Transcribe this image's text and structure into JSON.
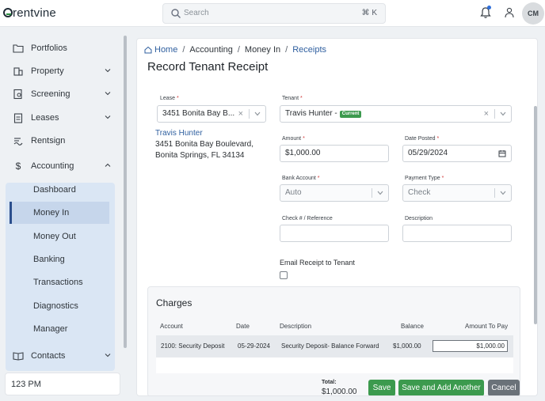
{
  "app": {
    "logo_text": "rentvine"
  },
  "search": {
    "placeholder": "Search",
    "shortcut": "⌘ K"
  },
  "header": {
    "avatar_initials": "CM",
    "notification_color": "#2f6fda"
  },
  "sidebar": {
    "items": [
      {
        "label": "Portfolios",
        "icon": "folder-icon"
      },
      {
        "label": "Property",
        "icon": "building-icon"
      },
      {
        "label": "Screening",
        "icon": "screening-icon"
      },
      {
        "label": "Leases",
        "icon": "clipboard-icon"
      },
      {
        "label": "Rentsign",
        "icon": "sign-icon"
      },
      {
        "label": "Accounting",
        "icon": "dollar-icon"
      },
      {
        "label": "Contacts",
        "icon": "book-icon"
      }
    ],
    "accounting_sub": [
      "Dashboard",
      "Money In",
      "Money Out",
      "Banking",
      "Transactions",
      "Diagnostics",
      "Manager"
    ],
    "active_sub": "Money In",
    "time_text": "123 PM"
  },
  "breadcrumb": {
    "home": "Home",
    "accounting": "Accounting",
    "money_in": "Money In",
    "current": "Receipts"
  },
  "page_title": "Record Tenant Receipt",
  "form": {
    "lease_label": "Lease",
    "lease_value": "3451 Bonita Bay B...",
    "tenant_label": "Tenant",
    "tenant_value": "Travis Hunter -",
    "tenant_badge": "Current",
    "tenant_link": "Travis Hunter",
    "address_line1": "3451 Bonita Bay Boulevard,",
    "address_line2": "Bonita Springs, FL 34134",
    "amount_label": "Amount",
    "amount_value": "$1,000.00",
    "date_label": "Date Posted",
    "date_value": "05/29/2024",
    "bank_label": "Bank Account",
    "bank_value": "Auto",
    "payment_label": "Payment Type",
    "payment_value": "Check",
    "check_label": "Check # / Reference",
    "check_value": "",
    "desc_label": "Description",
    "desc_value": "",
    "email_label": "Email Receipt to Tenant",
    "required_mark": "*"
  },
  "charges": {
    "title": "Charges",
    "columns": [
      "Account",
      "Date",
      "Description",
      "Balance",
      "Amount To Pay"
    ],
    "rows": [
      {
        "account": "2100: Security Deposit",
        "date": "05-29-2024",
        "description": "Security Deposit- Balance Forward",
        "balance": "$1,000.00",
        "amount_to_pay": "$1,000.00"
      }
    ]
  },
  "footer": {
    "total_label": "Total:",
    "total_value": "$1,000.00",
    "save": "Save",
    "save_add": "Save and Add Another",
    "cancel": "Cancel"
  },
  "colors": {
    "accent_green": "#3c9a4e",
    "link_blue": "#2f5f9f",
    "sidebar_active": "#dae6f4"
  }
}
